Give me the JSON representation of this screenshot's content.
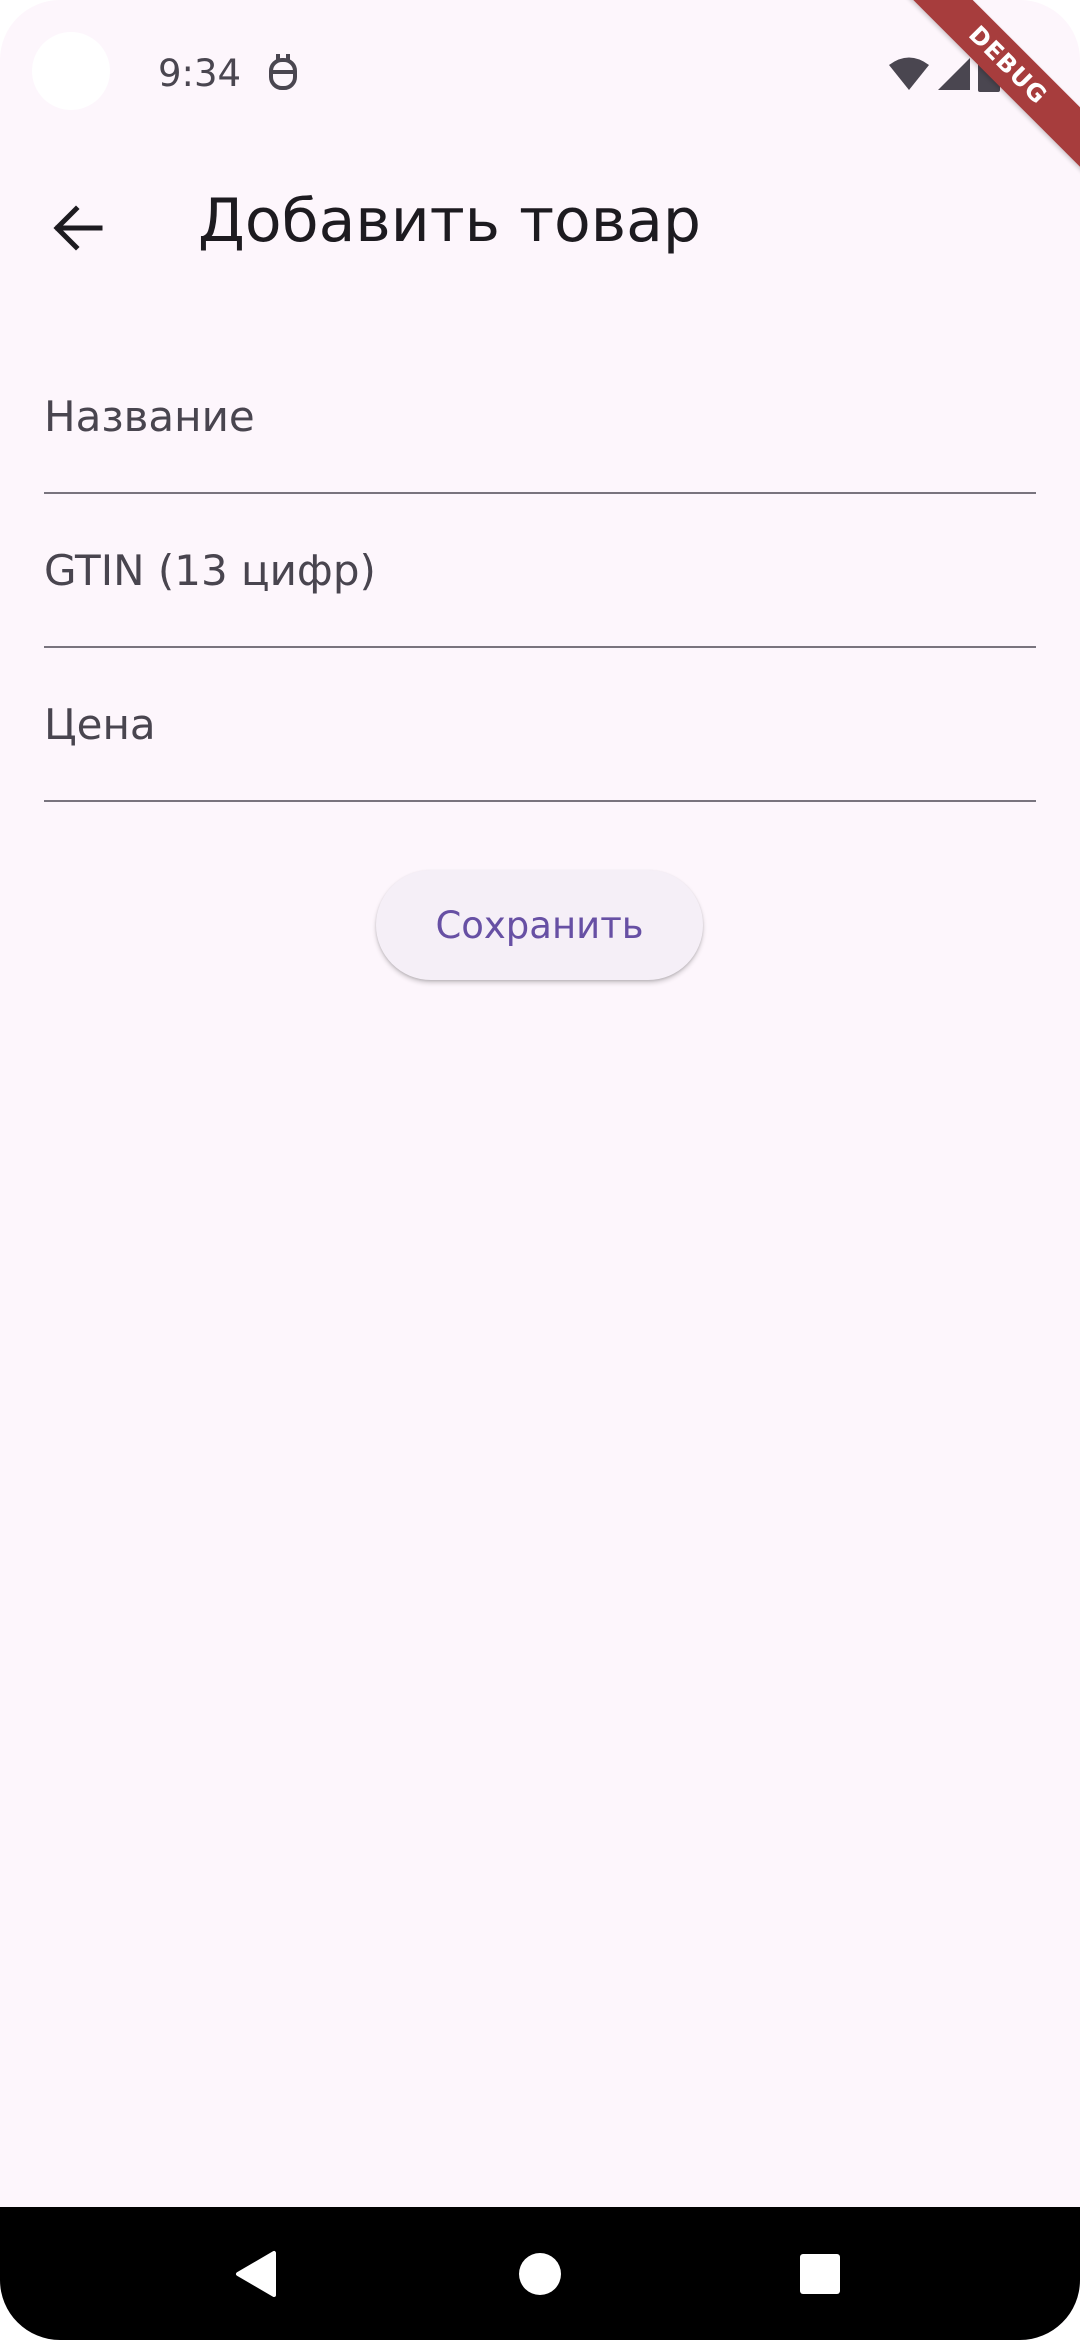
{
  "status_bar": {
    "time": "9:34",
    "icons": [
      "camera-cutout",
      "app-notification-icon",
      "wifi-icon",
      "signal-icon",
      "battery-icon"
    ]
  },
  "debug_banner": {
    "label": "DEBUG",
    "color": "#a73d3d"
  },
  "app_bar": {
    "back_icon": "arrow-back-icon",
    "title": "Добавить товар"
  },
  "form": {
    "fields": [
      {
        "name": "name",
        "placeholder": "Название",
        "value": ""
      },
      {
        "name": "gtin",
        "placeholder": "GTIN (13 цифр)",
        "value": ""
      },
      {
        "name": "price",
        "placeholder": "Цена",
        "value": ""
      }
    ],
    "save_label": "Сохранить"
  },
  "nav_bar": {
    "buttons": [
      "back-triangle-icon",
      "home-circle-icon",
      "recents-square-icon"
    ]
  },
  "colors": {
    "background": "#fdf6fc",
    "title_text": "#1d1b20",
    "placeholder_text": "#49454f",
    "underline": "#79747e",
    "button_bg": "#f5eff7",
    "button_text": "#6750a4",
    "nav_bar": "#000000"
  }
}
